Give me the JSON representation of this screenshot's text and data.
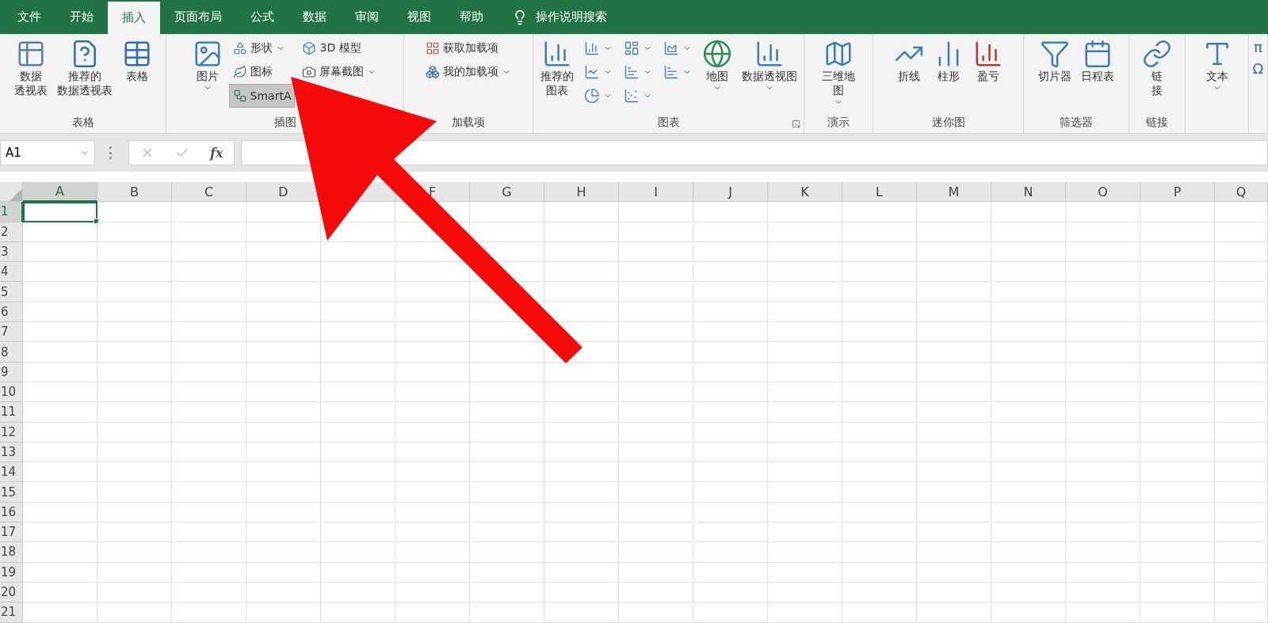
{
  "menu_tabs": [
    {
      "label": "文件",
      "selected": false
    },
    {
      "label": "开始",
      "selected": false
    },
    {
      "label": "插入",
      "selected": true
    },
    {
      "label": "页面布局",
      "selected": false
    },
    {
      "label": "公式",
      "selected": false
    },
    {
      "label": "数据",
      "selected": false
    },
    {
      "label": "审阅",
      "selected": false
    },
    {
      "label": "视图",
      "selected": false
    },
    {
      "label": "帮助",
      "selected": false
    }
  ],
  "tell_me": {
    "placeholder": "操作说明搜索"
  },
  "ribbon": {
    "groups": [
      {
        "label": "表格",
        "columns": [
          [
            {
              "kind": "large",
              "lines": [
                "数据",
                "透视表"
              ],
              "selected": false
            }
          ],
          [
            {
              "kind": "large",
              "lines": [
                "推荐的",
                "数据透视表"
              ],
              "selected": false
            }
          ],
          [
            {
              "kind": "large",
              "lines": [
                "表格"
              ],
              "selected": false
            }
          ]
        ]
      },
      {
        "label": "插图",
        "columns": [
          [
            {
              "kind": "large",
              "lines": [
                "图片"
              ],
              "dropdown": true,
              "selected": false
            }
          ],
          [
            {
              "kind": "small",
              "lines": [
                "形状"
              ],
              "dropdown": true,
              "selected": false
            },
            {
              "kind": "small",
              "lines": [
                "图标"
              ],
              "selected": false
            },
            {
              "kind": "small",
              "lines": [
                "SmartA"
              ],
              "selected": true
            }
          ],
          [
            {
              "kind": "small",
              "lines": [
                "3D 模型"
              ],
              "selected": false
            },
            {
              "kind": "small",
              "lines": [
                "屏幕截图"
              ],
              "dropdown": true,
              "selected": false
            }
          ]
        ]
      },
      {
        "label": "加载项",
        "columns": [
          [
            {
              "kind": "small",
              "lines": [
                "获取加载项"
              ],
              "selected": false
            },
            {
              "kind": "small",
              "lines": [
                "我的加载项"
              ],
              "dropdown": true,
              "selected": false
            }
          ]
        ]
      },
      {
        "label": "图表",
        "launcher": true,
        "columns": [
          [
            {
              "kind": "large",
              "lines": [
                "推荐的",
                "图表"
              ],
              "selected": false
            }
          ],
          [
            {
              "kind": "icon",
              "dropdown": true,
              "selected": false
            },
            {
              "kind": "icon",
              "dropdown": true,
              "selected": false
            },
            {
              "kind": "icon",
              "dropdown": true,
              "selected": false
            }
          ],
          [
            {
              "kind": "icon",
              "dropdown": true,
              "selected": false
            },
            {
              "kind": "icon",
              "dropdown": true,
              "selected": false
            },
            {
              "kind": "icon",
              "dropdown": true,
              "selected": false
            }
          ],
          [
            {
              "kind": "icon",
              "dropdown": true,
              "selected": false
            },
            {
              "kind": "icon",
              "dropdown": true,
              "selected": false
            }
          ],
          [
            {
              "kind": "large",
              "lines": [
                "地图"
              ],
              "dropdown": true,
              "selected": false
            }
          ],
          [
            {
              "kind": "large",
              "lines": [
                "数据透视图"
              ],
              "dropdown": true,
              "selected": false
            }
          ]
        ]
      },
      {
        "label": "演示",
        "columns": [
          [
            {
              "kind": "large",
              "lines": [
                "三维地",
                "图"
              ],
              "dropdown": true,
              "selected": false
            }
          ]
        ]
      },
      {
        "label": "迷你图",
        "columns": [
          [
            {
              "kind": "large",
              "lines": [
                "折线"
              ],
              "selected": false
            }
          ],
          [
            {
              "kind": "large",
              "lines": [
                "柱形"
              ],
              "selected": false
            }
          ],
          [
            {
              "kind": "large",
              "lines": [
                "盈亏"
              ],
              "selected": false
            }
          ]
        ]
      },
      {
        "label": "筛选器",
        "columns": [
          [
            {
              "kind": "large",
              "lines": [
                "切片器"
              ],
              "selected": false
            }
          ],
          [
            {
              "kind": "large",
              "lines": [
                "日程表"
              ],
              "selected": false
            }
          ]
        ]
      },
      {
        "label": "链接",
        "columns": [
          [
            {
              "kind": "large",
              "lines": [
                "链",
                "接"
              ],
              "selected": false
            }
          ]
        ]
      },
      {
        "columns": [
          [
            {
              "kind": "large",
              "lines": [
                "文本"
              ],
              "dropdown": true,
              "selected": false
            }
          ]
        ]
      },
      {
        "columns": [
          [
            {
              "kind": "glyph",
              "lines": [
                "π"
              ],
              "selected": false
            },
            {
              "kind": "glyph",
              "lines": [
                "Ω"
              ],
              "selected": false
            }
          ]
        ]
      }
    ]
  },
  "formula_bar": {
    "name_box": "A1",
    "function_label": "fx"
  },
  "sheet": {
    "columns": [
      {
        "label": "A",
        "selected": true
      },
      {
        "label": "B",
        "selected": false
      },
      {
        "label": "C",
        "selected": false
      },
      {
        "label": "D",
        "selected": false
      },
      {
        "selected": false
      },
      {
        "label": "F",
        "selected": false
      },
      {
        "label": "G",
        "selected": false
      },
      {
        "label": "H",
        "selected": false
      },
      {
        "label": "I",
        "selected": false
      },
      {
        "label": "J",
        "selected": false
      },
      {
        "label": "K",
        "selected": false
      },
      {
        "label": "L",
        "selected": false
      },
      {
        "label": "M",
        "selected": false
      },
      {
        "label": "N",
        "selected": false
      },
      {
        "label": "O",
        "selected": false
      },
      {
        "label": "P",
        "selected": false
      },
      {
        "label": "Q",
        "selected": false
      }
    ],
    "rows": [
      {
        "label": "1",
        "selected": true
      },
      {
        "label": "2",
        "selected": false
      },
      {
        "label": "3",
        "selected": false
      },
      {
        "label": "4",
        "selected": false
      },
      {
        "label": "5",
        "selected": false
      },
      {
        "label": "6",
        "selected": false
      },
      {
        "label": "7",
        "selected": false
      },
      {
        "label": "8",
        "selected": false
      },
      {
        "label": "9",
        "selected": false
      },
      {
        "label": "10",
        "selected": false
      },
      {
        "label": "11",
        "selected": false
      },
      {
        "label": "12",
        "selected": false
      },
      {
        "label": "13",
        "selected": false
      },
      {
        "label": "14",
        "selected": false
      },
      {
        "label": "15",
        "selected": false
      },
      {
        "label": "16",
        "selected": false
      },
      {
        "label": "17",
        "selected": false
      },
      {
        "label": "18",
        "selected": false
      },
      {
        "label": "19",
        "selected": false
      },
      {
        "label": "20",
        "selected": false
      },
      {
        "label": "21",
        "selected": false
      }
    ]
  },
  "annotation": {
    "kind": "arrow"
  }
}
